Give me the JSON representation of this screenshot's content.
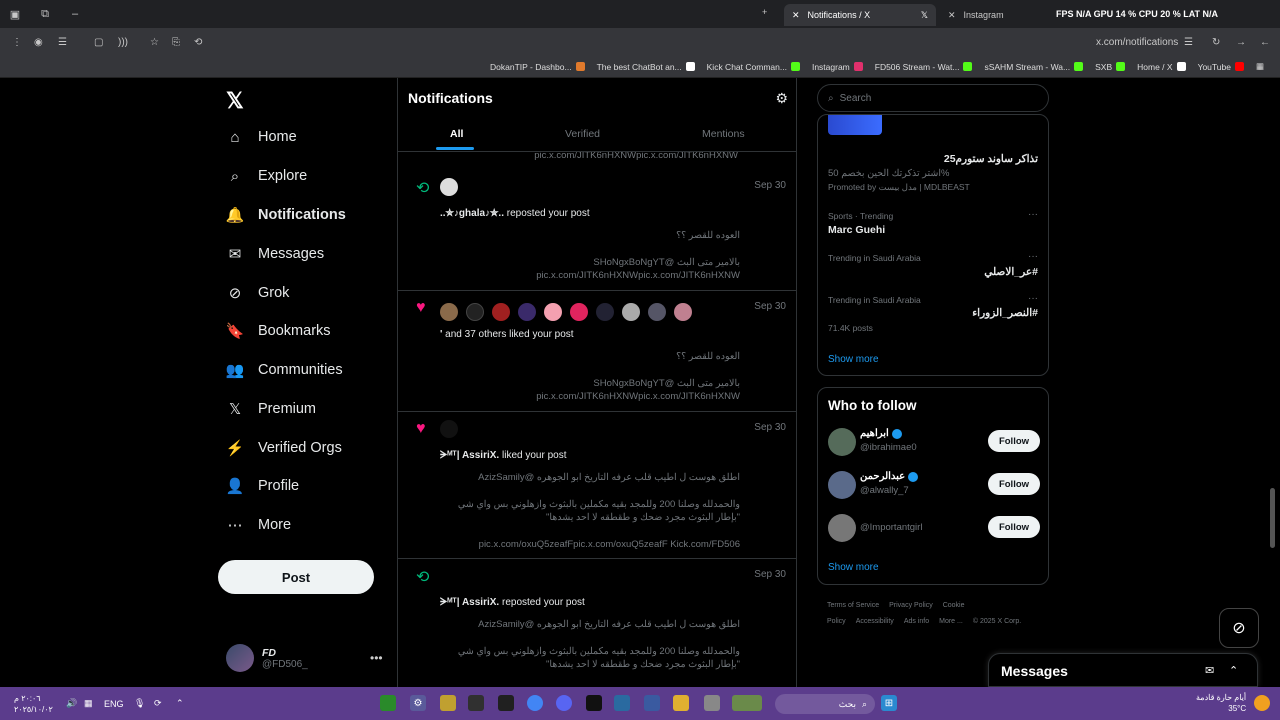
{
  "browser": {
    "tabs": [
      {
        "label": "Notifications / X"
      },
      {
        "label": "Instagram"
      }
    ],
    "overlay_text": "FPS N/A   GPU 14 %   CPU 20 %   LAT N/A",
    "url": "x.com/notifications",
    "bookmarks": [
      {
        "label": "DokanTIP - Dashbo...",
        "color": "#e07a2c"
      },
      {
        "label": "The best ChatBot an...",
        "color": "#ffffff"
      },
      {
        "label": "Kick Chat Comman...",
        "color": "#53fc18"
      },
      {
        "label": "Instagram",
        "color": "#e1306c"
      },
      {
        "label": "FD506 Stream - Wat...",
        "color": "#53fc18"
      },
      {
        "label": "sSAHM Stream - Wa...",
        "color": "#53fc18"
      },
      {
        "label": "SXB",
        "color": "#53fc18"
      },
      {
        "label": "Home / X",
        "color": "#ffffff"
      },
      {
        "label": "YouTube",
        "color": "#ff0000"
      }
    ]
  },
  "nav": {
    "logo": "𝕏",
    "items": [
      {
        "label": "Home",
        "icon": "⌂"
      },
      {
        "label": "Explore",
        "icon": "⌕"
      },
      {
        "label": "Notifications",
        "icon": "🔔"
      },
      {
        "label": "Messages",
        "icon": "✉"
      },
      {
        "label": "Grok",
        "icon": "⊘"
      },
      {
        "label": "Bookmarks",
        "icon": "🔖"
      },
      {
        "label": "Communities",
        "icon": "👥"
      },
      {
        "label": "Premium",
        "icon": "𝕏"
      },
      {
        "label": "Verified Orgs",
        "icon": "⚡"
      },
      {
        "label": "Profile",
        "icon": "👤"
      },
      {
        "label": "More",
        "icon": "⋯"
      }
    ],
    "post_label": "Post",
    "user": {
      "name": "FD",
      "handle": "@FD506_"
    }
  },
  "center": {
    "title": "Notifications",
    "tabs": [
      {
        "label": "All"
      },
      {
        "label": "Verified"
      },
      {
        "label": "Mentions"
      }
    ],
    "top_link": "pic.x.com/JITK6nHXNWpic.x.com/JITK6nHXNW",
    "notifications": [
      {
        "date": "Sep 30",
        "actor": "..✮♪ghala♪✮..",
        "action": "reposted your post",
        "lines": [
          "العوده للقصر ؟؟",
          "بالامير متى البث @SHoNgxBoNgYT",
          "pic.x.com/JITK6nHXNWpic.x.com/JITK6nHXNW"
        ]
      },
      {
        "date": "Sep 30",
        "actor": "'",
        "action": "and 37 others liked your post",
        "lines": [
          "العوده للقصر ؟؟",
          "بالامير متى البث @SHoNgxBoNgYT",
          "pic.x.com/JITK6nHXNWpic.x.com/JITK6nHXNW"
        ]
      },
      {
        "date": "Sep 30",
        "actor": "ᗒᴹᵀ| AssiriX.",
        "action": "liked your post",
        "lines": [
          "اطلق هوست ل اطيب قلب عرفه التاريخ ابو الجوهره @AzizSamily",
          "والحمدلله وصلنا 200 وللمجد بقيه مكملين بالبثوث وازهلوني بس واي شي",
          "\"بإطار البثوث مجرد ضحك و طقطقه لا احد يشدها\"",
          "pic.x.com/oxuQ5zeafFpic.x.com/oxuQ5zeafF Kick.com/FD506"
        ]
      },
      {
        "date": "Sep 30",
        "actor": "ᗒᴹᵀ| AssiriX.",
        "action": "reposted your post",
        "lines": [
          "اطلق هوست ل اطيب قلب عرفه التاريخ ابو الجوهره @AzizSamily",
          "والحمدلله وصلنا 200 وللمجد بقيه مكملين بالبثوث وازهلوني بس واي شي",
          "\"بإطار البثوث مجرد ضحك و طقطقه لا احد يشدها\""
        ]
      }
    ]
  },
  "right": {
    "search_placeholder": "Search",
    "ad": {
      "title": "تذاكر ساوند ستورم25",
      "desc": "اشتر تذكرتك الحين بخصم 50%",
      "promoted": "Promoted by مدل بيست | MDLBEAST"
    },
    "trends": [
      {
        "context": "Sports · Trending",
        "name": "Marc Guehi",
        "posts": ""
      },
      {
        "context": "Trending in Saudi Arabia",
        "name": "#عر_الاصلي",
        "posts": ""
      },
      {
        "context": "Trending in Saudi Arabia",
        "name": "#النصر_الزوراء",
        "posts": "71.4K posts"
      }
    ],
    "show_more": "Show more",
    "who_to_follow": {
      "title": "Who to follow",
      "people": [
        {
          "name": "ابراهيم",
          "handle": "@ibrahimae0",
          "verified": true
        },
        {
          "name": "عبدالرحمن",
          "handle": "@alwally_7",
          "verified": true
        },
        {
          "name": "",
          "handle": "@Importantgirl",
          "verified": false
        }
      ],
      "follow_label": "Follow",
      "show_more": "Show more"
    },
    "footer": [
      "Terms of Service",
      "Privacy Policy",
      "Cookie Policy",
      "Accessibility",
      "Ads info",
      "More ...",
      "© 2025 X Corp."
    ]
  },
  "messages_bar": {
    "title": "Messages"
  },
  "taskbar": {
    "search_text": "بحث",
    "lang": "ENG",
    "time": "٢٠:٠٦ م",
    "date": "٢٠٢٥/١٠/٠٢",
    "weather": "أيام حارة قادمة",
    "temp": "35°C"
  },
  "colors": {
    "accent": "#1d9bf0",
    "like": "#f91880",
    "repost": "#00ba7c",
    "taskbar": "#5b3c8c"
  }
}
